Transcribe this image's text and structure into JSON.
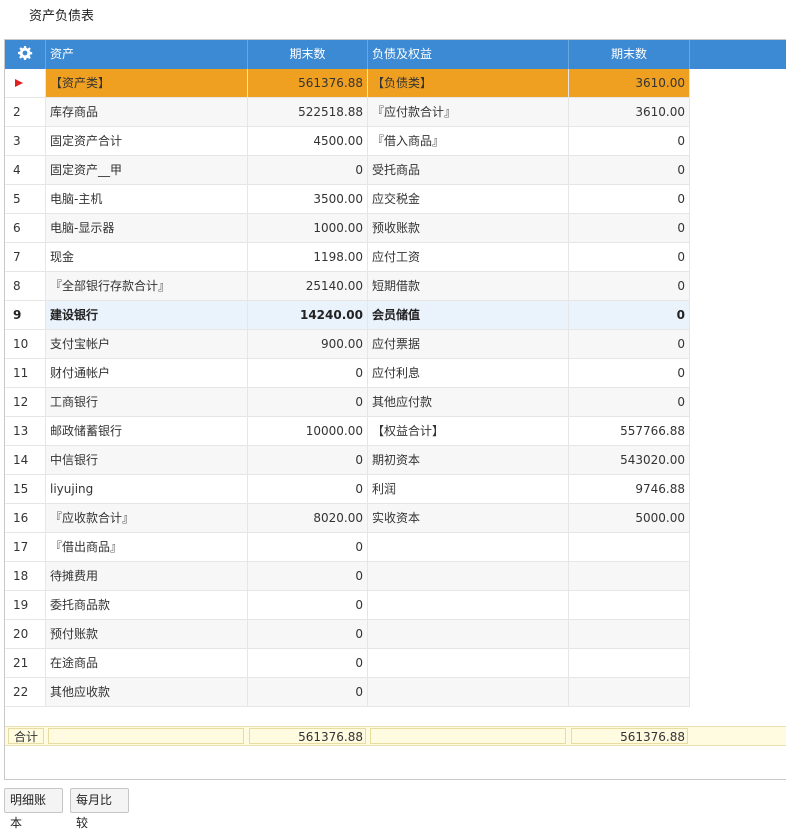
{
  "page": {
    "title": "资产负债表"
  },
  "columns": {
    "asset": "资产",
    "asset_end": "期末数",
    "liab": "负债及权益",
    "liab_end": "期末数"
  },
  "rows": [
    {
      "no": "",
      "asset": "【资产类】",
      "asset_end": "561376.88",
      "liab": "【负债类】",
      "liab_end": "3610.00"
    },
    {
      "no": "2",
      "asset": "库存商品",
      "asset_end": "522518.88",
      "liab": "『应付款合计』",
      "liab_end": "3610.00"
    },
    {
      "no": "3",
      "asset": "固定资产合计",
      "asset_end": "4500.00",
      "liab": "『借入商品』",
      "liab_end": "0"
    },
    {
      "no": "4",
      "asset": "固定资产__甲",
      "asset_end": "0",
      "liab": "受托商品",
      "liab_end": "0"
    },
    {
      "no": "5",
      "asset": "电脑-主机",
      "asset_end": "3500.00",
      "liab": "应交税金",
      "liab_end": "0"
    },
    {
      "no": "6",
      "asset": "电脑-显示器",
      "asset_end": "1000.00",
      "liab": "预收账款",
      "liab_end": "0"
    },
    {
      "no": "7",
      "asset": "现金",
      "asset_end": "1198.00",
      "liab": "应付工资",
      "liab_end": "0"
    },
    {
      "no": "8",
      "asset": "『全部银行存款合计』",
      "asset_end": "25140.00",
      "liab": "短期借款",
      "liab_end": "0"
    },
    {
      "no": "9",
      "asset": "建设银行",
      "asset_end": "14240.00",
      "liab": "会员储值",
      "liab_end": "0"
    },
    {
      "no": "10",
      "asset": "支付宝帐户",
      "asset_end": "900.00",
      "liab": "应付票据",
      "liab_end": "0"
    },
    {
      "no": "11",
      "asset": "财付通帐户",
      "asset_end": "0",
      "liab": "应付利息",
      "liab_end": "0"
    },
    {
      "no": "12",
      "asset": "工商银行",
      "asset_end": "0",
      "liab": "其他应付款",
      "liab_end": "0"
    },
    {
      "no": "13",
      "asset": "邮政储蓄银行",
      "asset_end": "10000.00",
      "liab": "【权益合计】",
      "liab_end": "557766.88"
    },
    {
      "no": "14",
      "asset": "中信银行",
      "asset_end": "0",
      "liab": "期初资本",
      "liab_end": "543020.00"
    },
    {
      "no": "15",
      "asset": "liyujing",
      "asset_end": "0",
      "liab": "利润",
      "liab_end": "9746.88"
    },
    {
      "no": "16",
      "asset": "『应收款合计』",
      "asset_end": "8020.00",
      "liab": "实收资本",
      "liab_end": "5000.00"
    },
    {
      "no": "17",
      "asset": "『借出商品』",
      "asset_end": "0",
      "liab": "",
      "liab_end": ""
    },
    {
      "no": "18",
      "asset": "待摊费用",
      "asset_end": "0",
      "liab": "",
      "liab_end": ""
    },
    {
      "no": "19",
      "asset": "委托商品款",
      "asset_end": "0",
      "liab": "",
      "liab_end": ""
    },
    {
      "no": "20",
      "asset": "预付账款",
      "asset_end": "0",
      "liab": "",
      "liab_end": ""
    },
    {
      "no": "21",
      "asset": "在途商品",
      "asset_end": "0",
      "liab": "",
      "liab_end": ""
    },
    {
      "no": "22",
      "asset": "其他应收款",
      "asset_end": "0",
      "liab": "",
      "liab_end": ""
    }
  ],
  "footer": {
    "label": "合计",
    "asset_total": "561376.88",
    "liab_total": "561376.88"
  },
  "buttons": {
    "detail": "明细账本",
    "monthly": "每月比较"
  },
  "icons": {
    "settings": "gear-icon",
    "current_row": "row-pointer-icon"
  },
  "colors": {
    "header": "#3d8ad4",
    "selected_row": "#f0a020",
    "hover_row": "#eaf2fc",
    "footer": "#fffbe0"
  }
}
